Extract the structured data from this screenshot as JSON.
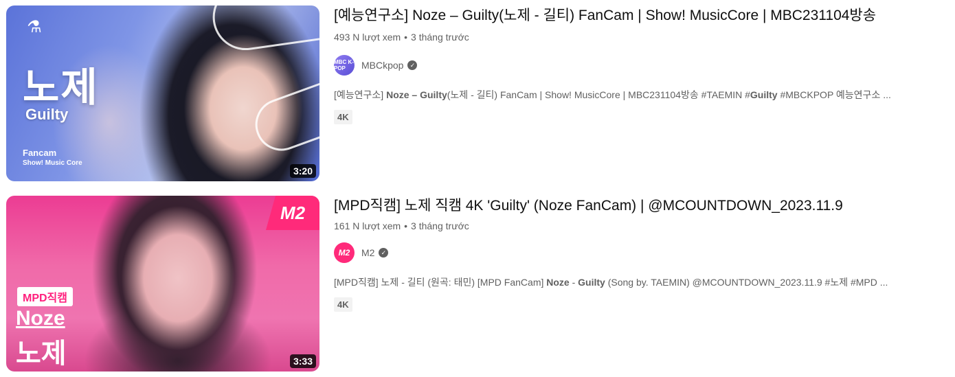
{
  "videos": [
    {
      "title": "[예능연구소] Noze – Guilty(노제 - 길티) FanCam | Show! MusicCore | MBC231104방송",
      "views": "493 N lượt xem",
      "separator": "•",
      "age": "3 tháng trước",
      "channel": "MBCkpop",
      "avatar_text": "MBC K-POP",
      "snippet_parts": [
        {
          "text": "[예능연구소] ",
          "bold": false
        },
        {
          "text": "Noze – Guilty",
          "bold": true
        },
        {
          "text": "(노제 - 길티) FanCam | Show! MusicCore | MBC231104방송 #TAEMIN #",
          "bold": false
        },
        {
          "text": "Guilty",
          "bold": true
        },
        {
          "text": " #MBCKPOP 예능연구소 ...",
          "bold": false
        }
      ],
      "badge": "4K",
      "duration": "3:20",
      "thumb": {
        "big_text": "노제",
        "sub_text": "Guilty",
        "small_1": "Fancam",
        "small_2": "Show! Music Core",
        "logo": "flask-icon"
      }
    },
    {
      "title": "[MPD직캠] 노제 직캠 4K 'Guilty' (Noze FanCam) | @MCOUNTDOWN_2023.11.9",
      "views": "161 N lượt xem",
      "separator": "•",
      "age": "3 tháng trước",
      "channel": "M2",
      "avatar_text": "M2",
      "snippet_parts": [
        {
          "text": "[MPD직캠] 노제 - 길티 (원곡: 태민) [MPD FanCam] ",
          "bold": false
        },
        {
          "text": "Noze",
          "bold": true
        },
        {
          "text": " - ",
          "bold": false
        },
        {
          "text": "Guilty",
          "bold": true
        },
        {
          "text": " (Song by. TAEMIN) @MCOUNTDOWN_2023.11.9 #노제 #MPD ...",
          "bold": false
        }
      ],
      "badge": "4K",
      "duration": "3:33",
      "thumb": {
        "logo_text": "M2",
        "mpd_badge": "MPD직캠",
        "noze_en": "Noze",
        "noze_kr": "노제"
      }
    }
  ],
  "verified_icon": "check-circle-icon",
  "colors": {
    "text_primary": "#0f0f0f",
    "text_secondary": "#606060",
    "badge_bg": "#f2f2f2",
    "m2_pink": "#ff2a7a"
  }
}
